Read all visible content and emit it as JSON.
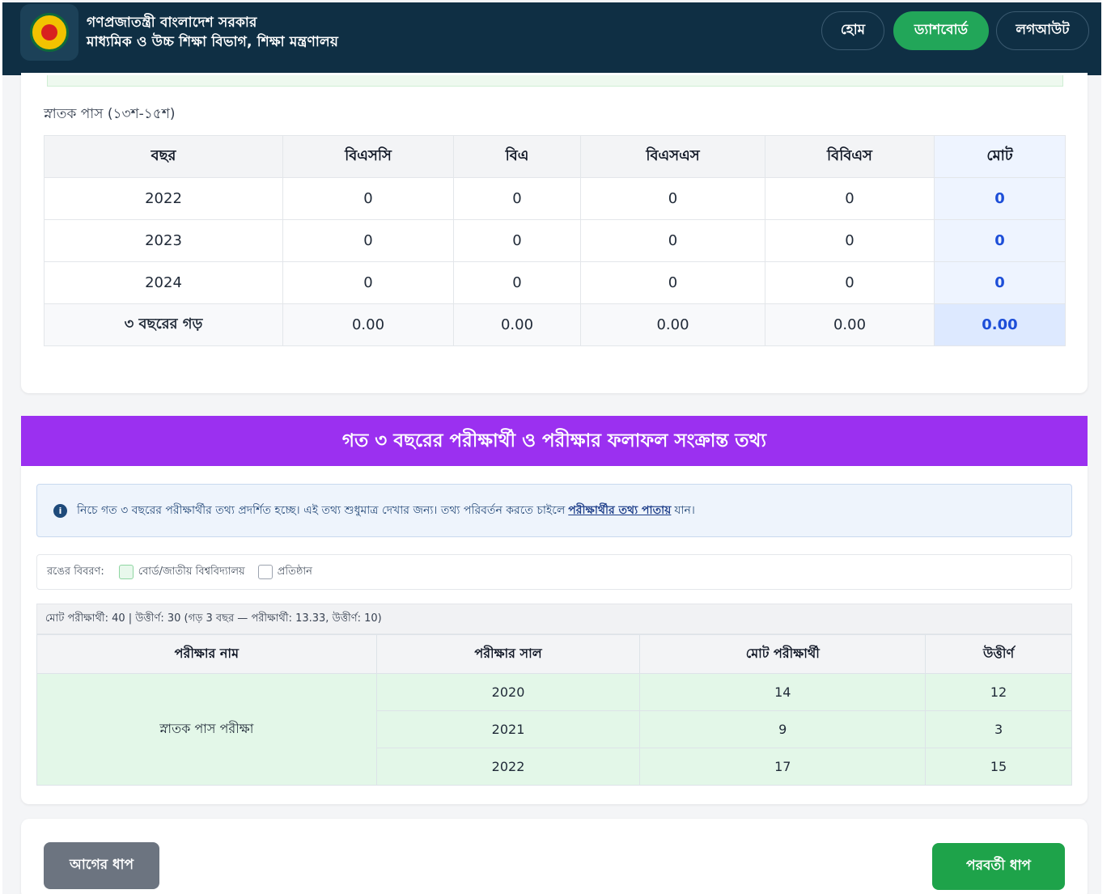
{
  "header": {
    "org_line1": "গণপ্রজাতন্ত্রী বাংলাদেশ সরকার",
    "org_line2": "মাধ্যমিক ও উচ্চ শিক্ষা বিভাগ, শিক্ষা মন্ত্রণালয়",
    "nav": {
      "home": "হোম",
      "dashboard": "ড্যাশবোর্ড",
      "logout": "লগআউট"
    },
    "colors": {
      "bar": "#0f2f44",
      "active": "#22a659"
    }
  },
  "graduation": {
    "label": "স্নাতক পাস (১৩শ-১৫শ)",
    "headers": [
      "বছর",
      "বিএসসি",
      "বিএ",
      "বিএসএস",
      "বিবিএস",
      "মোট"
    ],
    "rows": [
      [
        "2022",
        "0",
        "0",
        "0",
        "0",
        "0"
      ],
      [
        "2023",
        "0",
        "0",
        "0",
        "0",
        "0"
      ],
      [
        "2024",
        "0",
        "0",
        "0",
        "0",
        "0"
      ]
    ],
    "avg": [
      "৩ বছরের গড়",
      "0.00",
      "0.00",
      "0.00",
      "0.00",
      "0.00"
    ]
  },
  "exam_section": {
    "banner_title": "গত ৩ বছরের পরীক্ষার্থী ও পরীক্ষার ফলাফল সংক্রান্ত তথ্য",
    "banner_color": "#9b30f0",
    "info_text_before": "নিচে গত ৩ বছরের পরীক্ষার্থীর তথ্য প্রদর্শিত হচ্ছে। এই তথ্য শুধুমাত্র দেখার জন্য। তথ্য পরিবর্তন করতে চাইলে",
    "info_link": "পরীক্ষার্থীর তথ্য পাতায়",
    "info_text_after": "যান।",
    "legend_label": "রঙের বিবরণ:",
    "legend_board": "বোর্ড/জাতীয় বিশ্ববিদ্যালয়",
    "legend_institute": "প্রতিষ্ঠান",
    "summary": "মোট পরীক্ষার্থী: 40 | উত্তীর্ণ: 30 (গড় 3 বছর — পরীক্ষার্থী: 13.33, উত্তীর্ণ: 10)",
    "headers": [
      "পরীক্ষার নাম",
      "পরীক্ষার সাল",
      "মোট পরীক্ষার্থী",
      "উত্তীর্ণ"
    ],
    "exam_name": "স্নাতক পাস পরীক্ষা",
    "rows": [
      [
        "2020",
        "14",
        "12"
      ],
      [
        "2021",
        "9",
        "3"
      ],
      [
        "2022",
        "17",
        "15"
      ]
    ]
  },
  "footer": {
    "prev_label": "আগের ধাপ",
    "next_label": "পরবর্তী ধাপ"
  }
}
